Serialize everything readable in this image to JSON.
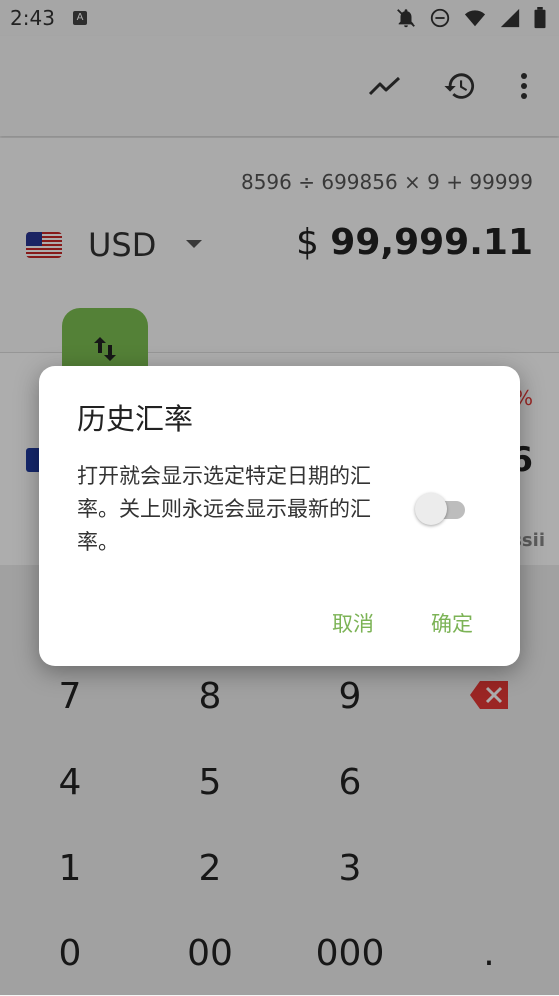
{
  "status": {
    "time": "2:43",
    "a_badge": "A"
  },
  "main": {
    "expression": "8596 ÷ 699856 × 9 + 99999",
    "from_currency": "USD",
    "from_symbol": "$",
    "from_amount": "99,999.11",
    "percent_partial": "%",
    "to_amount_partial": "6",
    "to_label_partial": "ssii"
  },
  "keypad": {
    "keys": [
      "7",
      "8",
      "9",
      "4",
      "5",
      "6",
      "1",
      "2",
      "3",
      "0",
      "00",
      "000",
      "."
    ]
  },
  "dialog": {
    "title": "历史汇率",
    "message": "打开就会显示选定特定日期的汇率。关上则永远会显示最新的汇率。",
    "switch_on": false,
    "cancel_label": "取消",
    "ok_label": "确定"
  },
  "colors": {
    "accent": "#7cb356",
    "swap_button": "#7cbf52",
    "delete": "#e53935"
  }
}
